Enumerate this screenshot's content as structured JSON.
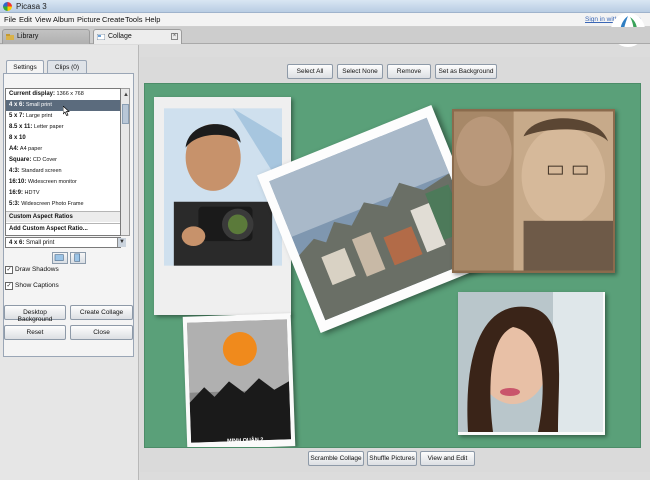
{
  "window": {
    "title": "Picasa 3"
  },
  "menu": [
    "File",
    "Edit",
    "View",
    "Album",
    "Picture",
    "Create",
    "Tools",
    "Help"
  ],
  "account": {
    "sign_in": "Sign in with Google"
  },
  "tabs": [
    {
      "label": "Library"
    },
    {
      "label": "Collage"
    }
  ],
  "left_panel": {
    "subtabs": [
      "Settings",
      "Clips (0)"
    ],
    "size_dropdown": {
      "options": [
        {
          "key": "Current display:",
          "value": "1366 x 768"
        },
        {
          "key": "4 x 6:",
          "value": "Small print",
          "selected": true
        },
        {
          "key": "5 x 7:",
          "value": "Large print"
        },
        {
          "key": "8.5 x 11:",
          "value": "Letter paper"
        },
        {
          "key": "8 x 10",
          "value": ""
        },
        {
          "key": "A4:",
          "value": "A4 paper"
        },
        {
          "key": "Square:",
          "value": "CD Cover"
        },
        {
          "key": "4:3:",
          "value": "Standard screen"
        },
        {
          "key": "16:10:",
          "value": "Widescreen monitor"
        },
        {
          "key": "16:9:",
          "value": "HDTV"
        },
        {
          "key": "5:3:",
          "value": "Widescreen Photo Frame"
        },
        {
          "key": "Custom Aspect Ratios",
          "value": ""
        },
        {
          "key": "Add Custom Aspect Ratio...",
          "value": ""
        }
      ],
      "selected_key": "4 x 6:",
      "selected_value": "Small print"
    },
    "checkboxes": [
      {
        "label": "Draw Shadows",
        "checked": true
      },
      {
        "label": "Show Captions",
        "checked": true
      }
    ],
    "buttons": {
      "desktop_background": "Desktop Background",
      "create_collage": "Create Collage",
      "reset": "Reset",
      "close": "Close"
    }
  },
  "toolbar": {
    "select_all": "Select All",
    "select_none": "Select None",
    "remove": "Remove",
    "set_as_background": "Set as Background"
  },
  "canvas": {
    "background_color": "#5aa079",
    "photo_caption": "MINH QUẬN 2"
  },
  "bottom_toolbar": {
    "scramble": "Scramble Collage",
    "shuffle": "Shuffle Pictures",
    "view_edit": "View and Edit"
  }
}
